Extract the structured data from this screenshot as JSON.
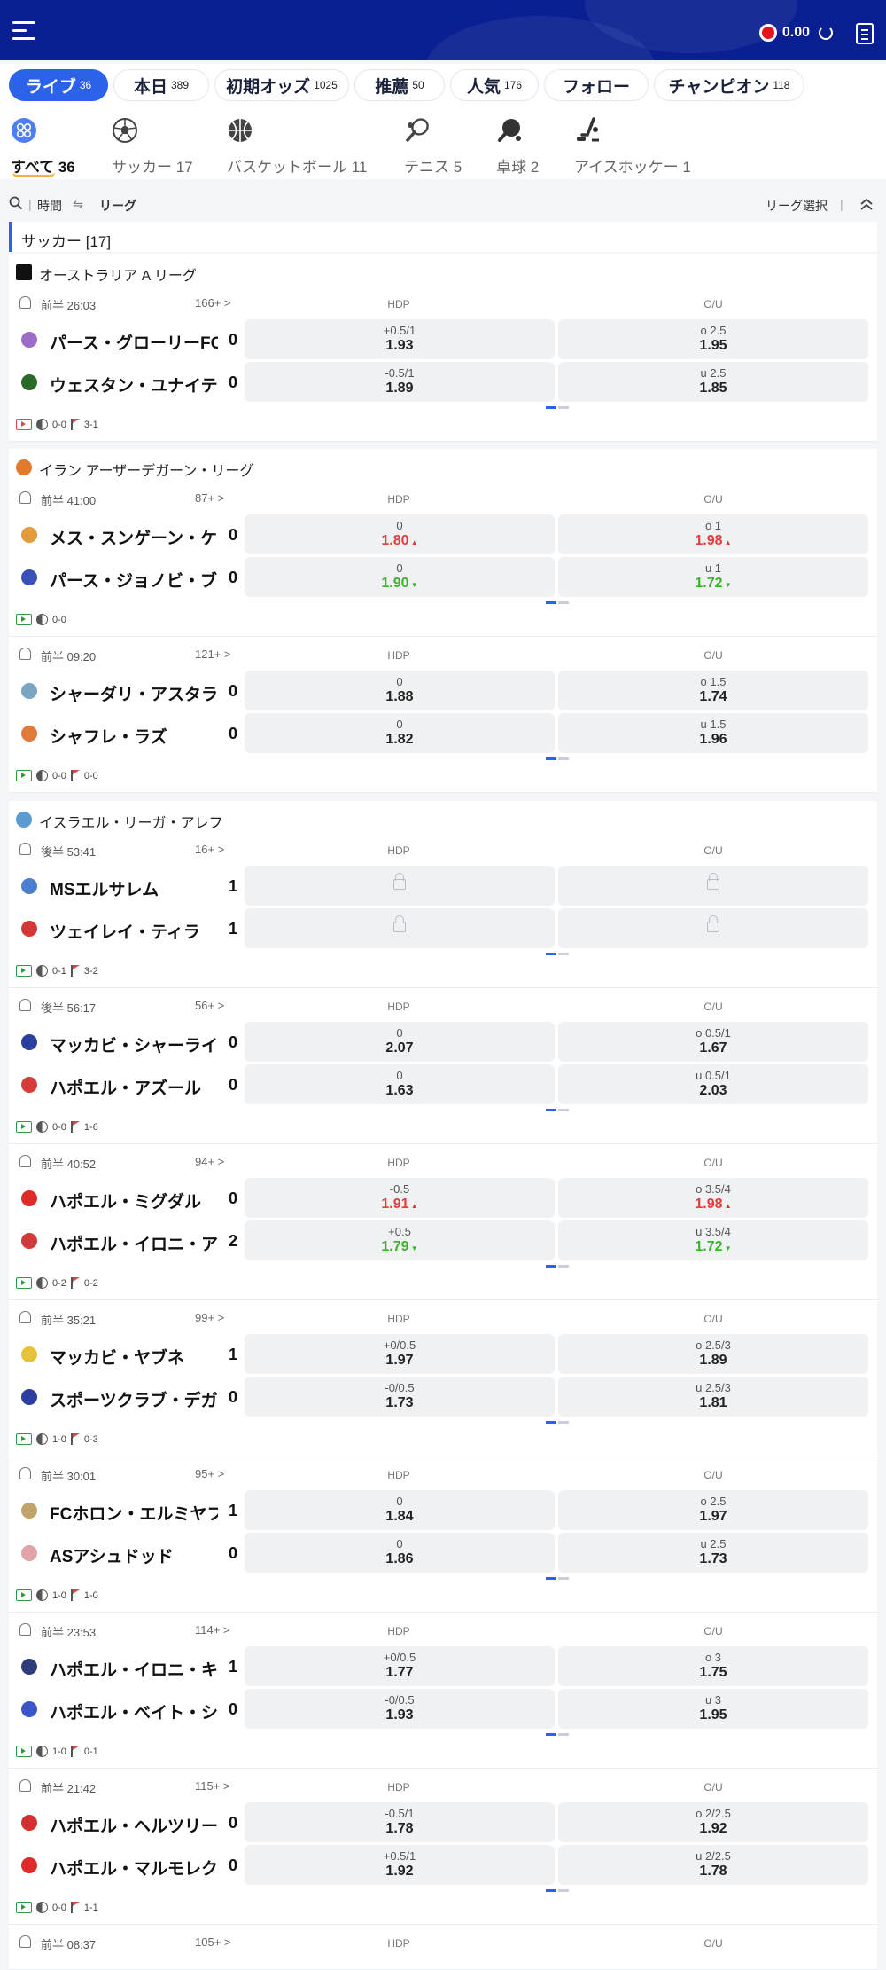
{
  "header": {
    "balance": "0.00"
  },
  "tabs": [
    {
      "label": "ライブ",
      "count": "36",
      "active": true
    },
    {
      "label": "本日",
      "count": "389"
    },
    {
      "label": "初期オッズ",
      "count": "1025"
    },
    {
      "label": "推薦",
      "count": "50"
    },
    {
      "label": "人気",
      "count": "176"
    },
    {
      "label": "フォロー",
      "count": ""
    },
    {
      "label": "チャンピオン",
      "count": "118"
    }
  ],
  "sports": [
    {
      "label": "すべて 36",
      "icon": "all-sports-icon"
    },
    {
      "label": "サッカー 17",
      "icon": "soccer-ball-icon"
    },
    {
      "label": "バスケットボール 11",
      "icon": "basketball-icon"
    },
    {
      "label": "テニス 5",
      "icon": "tennis-icon"
    },
    {
      "label": "卓球 2",
      "icon": "table-tennis-icon"
    },
    {
      "label": "アイスホッケー 1",
      "icon": "ice-hockey-icon"
    }
  ],
  "filter": {
    "time": "時間",
    "league": "リーグ",
    "select": "リーグ選択"
  },
  "section": {
    "title": "サッカー [17]"
  },
  "colors": {
    "brand": "#0a2092",
    "accent": "#2c61ea",
    "up": "#e33c3c",
    "down": "#39b52a"
  },
  "columns": {
    "hdp": "HDP",
    "ou": "O/U"
  },
  "leagues": [
    {
      "name": "オーストラリア A リーグ"
    },
    {
      "name": "イラン アーザーデガーン・リーグ"
    },
    {
      "name": "イスラエル・リーガ・アレフ"
    }
  ],
  "matches": [
    {
      "time": "前半 26:03",
      "more": "166+ >",
      "home": "パース・グローリーFC",
      "away": "ウェスタン・ユナイテッド",
      "hs": "0",
      "as": "0",
      "hdp": [
        {
          "l": "+0.5/1",
          "p": "1.93"
        },
        {
          "l": "-0.5/1",
          "p": "1.89"
        }
      ],
      "ou": [
        {
          "l": "o 2.5",
          "p": "1.95"
        },
        {
          "l": "u 2.5",
          "p": "1.85"
        }
      ],
      "f1": "0-0",
      "f2": "3-1",
      "video": true
    },
    {
      "time": "前半 41:00",
      "more": "87+ >",
      "home": "メス・スンゲーン・ケルマーン",
      "away": "パース・ジョノビ・ブーシェフル",
      "hs": "0",
      "as": "0",
      "hdp": [
        {
          "l": "0",
          "p": "1.80",
          "d": "up"
        },
        {
          "l": "0",
          "p": "1.90",
          "d": "dn"
        }
      ],
      "ou": [
        {
          "l": "o 1",
          "p": "1.98",
          "d": "up"
        },
        {
          "l": "u 1",
          "p": "1.72",
          "d": "dn"
        }
      ],
      "f1": "0-0",
      "f2": ""
    },
    {
      "time": "前半 09:20",
      "more": "121+ >",
      "home": "シャーダリ・アスタラ",
      "away": "シャフレ・ラズ",
      "hs": "0",
      "as": "0",
      "hdp": [
        {
          "l": "0",
          "p": "1.88"
        },
        {
          "l": "0",
          "p": "1.82"
        }
      ],
      "ou": [
        {
          "l": "o 1.5",
          "p": "1.74"
        },
        {
          "l": "u 1.5",
          "p": "1.96"
        }
      ],
      "f1": "0-0",
      "f2": "0-0"
    },
    {
      "time": "後半 53:41",
      "more": "16+ >",
      "home": "MSエルサレム",
      "away": "ツェイレイ・ティラ",
      "hs": "1",
      "as": "1",
      "locked": true,
      "f1": "0-1",
      "f2": "3-2"
    },
    {
      "time": "後半 56:17",
      "more": "56+ >",
      "home": "マッカビ・シャーライム",
      "away": "ハポエル・アズール",
      "hs": "0",
      "as": "0",
      "hdp": [
        {
          "l": "0",
          "p": "2.07"
        },
        {
          "l": "0",
          "p": "1.63"
        }
      ],
      "ou": [
        {
          "l": "o 0.5/1",
          "p": "1.67"
        },
        {
          "l": "u 0.5/1",
          "p": "2.03"
        }
      ],
      "f1": "0-0",
      "f2": "1-6"
    },
    {
      "time": "前半 40:52",
      "more": "94+ >",
      "home": "ハポエル・ミグダル",
      "away": "ハポエル・イロニ・アリエル",
      "hs": "0",
      "as": "2",
      "hdp": [
        {
          "l": "-0.5",
          "p": "1.91",
          "d": "up"
        },
        {
          "l": "+0.5",
          "p": "1.79",
          "d": "dn"
        }
      ],
      "ou": [
        {
          "l": "o 3.5/4",
          "p": "1.98",
          "d": "up"
        },
        {
          "l": "u 3.5/4",
          "p": "1.72",
          "d": "dn"
        }
      ],
      "f1": "0-2",
      "f2": "0-2"
    },
    {
      "time": "前半 35:21",
      "more": "99+ >",
      "home": "マッカビ・ヤブネ",
      "away": "スポーツクラブ・デガニア",
      "hs": "1",
      "as": "0",
      "hdp": [
        {
          "l": "+0/0.5",
          "p": "1.97"
        },
        {
          "l": "-0/0.5",
          "p": "1.73"
        }
      ],
      "ou": [
        {
          "l": "o 2.5/3",
          "p": "1.89"
        },
        {
          "l": "u 2.5/3",
          "p": "1.81"
        }
      ],
      "f1": "1-0",
      "f2": "0-3"
    },
    {
      "time": "前半 30:01",
      "more": "95+ >",
      "home": "FCホロン・エルミヤフ",
      "away": "ASアシュドッド",
      "hs": "1",
      "as": "0",
      "hdp": [
        {
          "l": "0",
          "p": "1.84"
        },
        {
          "l": "0",
          "p": "1.86"
        }
      ],
      "ou": [
        {
          "l": "o 2.5",
          "p": "1.97"
        },
        {
          "l": "u 2.5",
          "p": "1.73"
        }
      ],
      "f1": "1-0",
      "f2": "1-0"
    },
    {
      "time": "前半 23:53",
      "more": "114+ >",
      "home": "ハポエル・イロニ・キリヤット",
      "away": "ハポエル・ベイト・シェアン",
      "hs": "1",
      "as": "0",
      "hdp": [
        {
          "l": "+0/0.5",
          "p": "1.77"
        },
        {
          "l": "-0/0.5",
          "p": "1.93"
        }
      ],
      "ou": [
        {
          "l": "o 3",
          "p": "1.75"
        },
        {
          "l": "u 3",
          "p": "1.95"
        }
      ],
      "f1": "1-0",
      "f2": "0-1"
    },
    {
      "time": "前半 21:42",
      "more": "115+ >",
      "home": "ハポエル・ヘルツリーヤ",
      "away": "ハポエル・マルモレク",
      "hs": "0",
      "as": "0",
      "hdp": [
        {
          "l": "-0.5/1",
          "p": "1.78"
        },
        {
          "l": "+0.5/1",
          "p": "1.92"
        }
      ],
      "ou": [
        {
          "l": "o 2/2.5",
          "p": "1.92"
        },
        {
          "l": "u 2/2.5",
          "p": "1.78"
        }
      ],
      "f1": "0-0",
      "f2": "1-1"
    },
    {
      "time": "前半 08:37",
      "more": "105+ >",
      "partial": true
    }
  ]
}
